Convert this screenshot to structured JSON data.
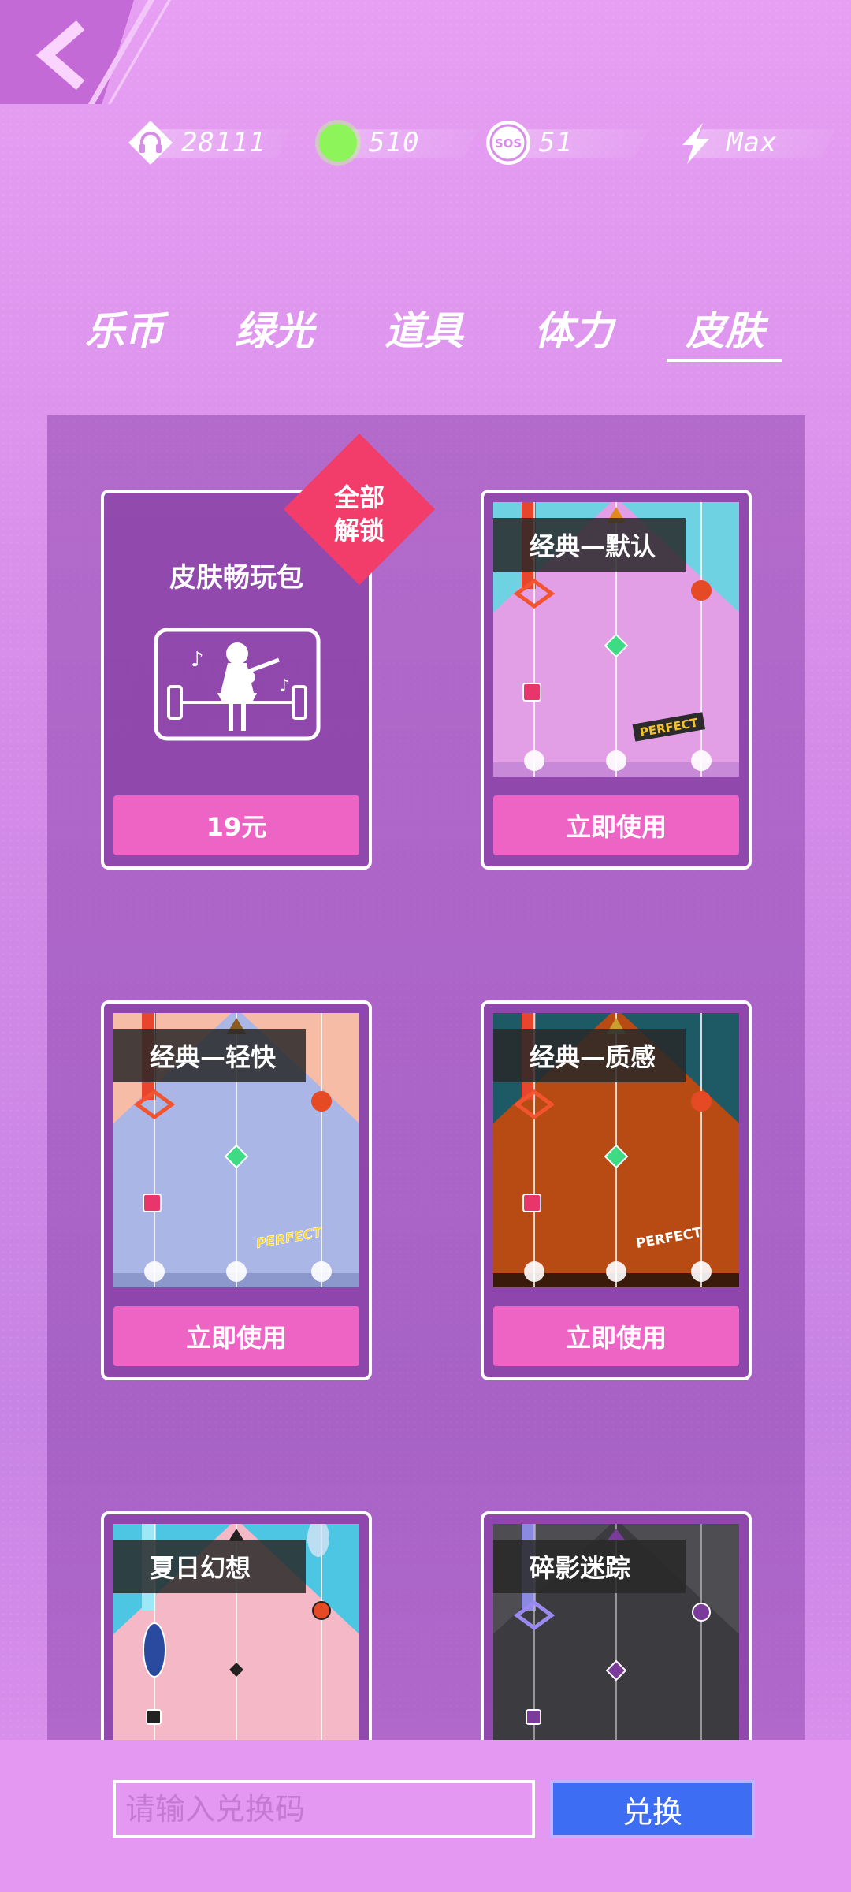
{
  "header": {
    "back_icon": "chevron-left-icon",
    "stats": [
      {
        "icon": "headphones-icon",
        "value": "28111"
      },
      {
        "icon": "green-light-icon",
        "value": "510"
      },
      {
        "icon": "sos-icon",
        "value": "51"
      },
      {
        "icon": "energy-icon",
        "value": "Max"
      }
    ]
  },
  "tabs": [
    {
      "label": "乐币"
    },
    {
      "label": "绿光"
    },
    {
      "label": "道具"
    },
    {
      "label": "体力"
    },
    {
      "label": "皮肤",
      "active": true
    }
  ],
  "bundle": {
    "title": "皮肤畅玩包",
    "badge": "全部\n解锁",
    "badge_line1": "全部",
    "badge_line2": "解锁",
    "price": "19元",
    "image_icon": "girl-guitar-icon"
  },
  "skins": [
    {
      "title": "经典—默认",
      "button": "立即使用",
      "judgement": "PERFECT"
    },
    {
      "title": "经典—轻快",
      "button": "立即使用",
      "judgement": "PERFECT"
    },
    {
      "title": "经典—质感",
      "button": "立即使用",
      "judgement": "PERFECT"
    },
    {
      "title": "夏日幻想"
    },
    {
      "title": "碎影迷踪"
    }
  ],
  "redeem": {
    "placeholder": "请输入兑换码",
    "button": "兑换"
  },
  "colors": {
    "accent_pink": "#ee64c4",
    "badge_red": "#f23c6a",
    "redeem_blue": "#3d6df2",
    "green_light": "#8df55a"
  }
}
